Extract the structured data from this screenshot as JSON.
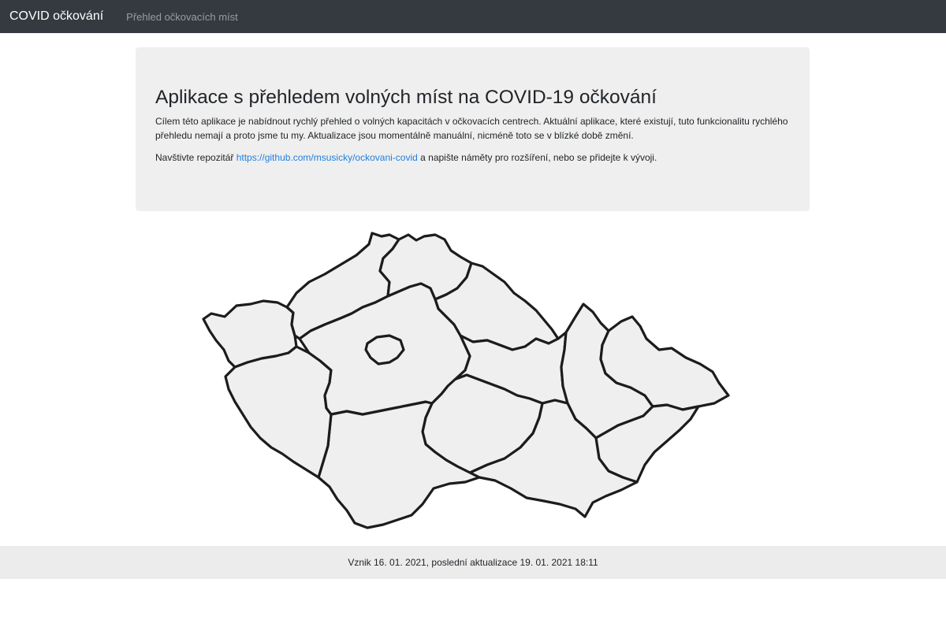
{
  "navbar": {
    "brand": "COVID očkování",
    "links": [
      "Přehled očkovacích míst"
    ]
  },
  "intro": {
    "title": "Aplikace s přehledem volných míst na COVID-19 očkování",
    "paragraph1": "Cílem této aplikace je nabídnout rychlý přehled o volných kapacitách v očkovacích centrech. Aktuální aplikace, které existují, tuto funkcionalitu rychlého přehledu nemají a proto jsme tu my. Aktualizace jsou momentálně manuální, nicméně toto se v blízké době změní.",
    "paragraph2_before": "Navštivte repozitář ",
    "repo_link": "https://github.com/msusicky/ockovani-covid",
    "paragraph2_after": " a napište náměty pro rozšíření, nebo se přidejte k vývoji."
  },
  "footer": {
    "text": "Vznik 16. 01. 2021, poslední aktualizace 19. 01. 2021 18:11"
  },
  "colors": {
    "navbar_bg": "#343a40",
    "jumbotron_bg": "#efefef",
    "link": "#1f7fdd",
    "map_fill": "#efefef",
    "map_stroke": "#1c1c1c",
    "footer_bg": "#ececec"
  }
}
